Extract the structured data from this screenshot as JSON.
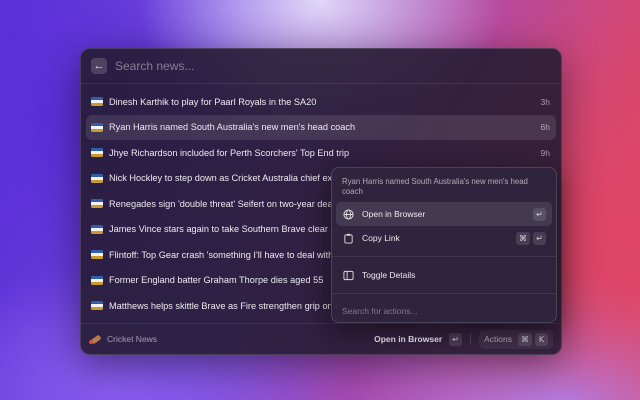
{
  "search": {
    "placeholder": "Search news...",
    "value": ""
  },
  "icons": {
    "back": "arrow-left-icon",
    "globe": "globe-icon",
    "clipboard": "clipboard-icon",
    "sidebar": "sidebar-icon"
  },
  "news": [
    {
      "title": "Dinesh Karthik to play for Paarl Royals in the SA20",
      "time": "3h"
    },
    {
      "title": "Ryan Harris named South Australia's new men's head coach",
      "time": "6h",
      "selected": true
    },
    {
      "title": "Jhye Richardson included for Perth Scorchers' Top End trip",
      "time": "9h"
    },
    {
      "title": "Nick Hockley to step down as Cricket Australia chief exe",
      "time": ""
    },
    {
      "title": "Renegades sign 'double threat' Seifert on two-year deal",
      "time": ""
    },
    {
      "title": "James Vince stars again to take Southern Brave clear at",
      "time": ""
    },
    {
      "title": "Flintoff: Top Gear crash 'something I'll have to deal with",
      "time": ""
    },
    {
      "title": "Former England batter Graham Thorpe dies aged 55",
      "time": ""
    },
    {
      "title": "Matthews helps skittle Brave as Fire strengthen grip on t",
      "time": ""
    }
  ],
  "footer": {
    "extension_name": "Cricket News",
    "primary_action": "Open in Browser",
    "primary_key": "↵",
    "actions_label": "Actions",
    "actions_keys": [
      "⌘",
      "K"
    ]
  },
  "popup": {
    "title": "Ryan Harris named South Australia's new men's head coach",
    "items": [
      {
        "label": "Open in Browser",
        "keys": [
          "↵"
        ]
      },
      {
        "label": "Copy Link",
        "keys": [
          "⌘",
          "↵"
        ]
      },
      {
        "label": "Toggle Details",
        "keys": []
      }
    ],
    "search_placeholder": "Search for actions..."
  },
  "colors": {
    "favicon_blue": "#2e5fa8",
    "favicon_gold": "#c79a2e"
  }
}
